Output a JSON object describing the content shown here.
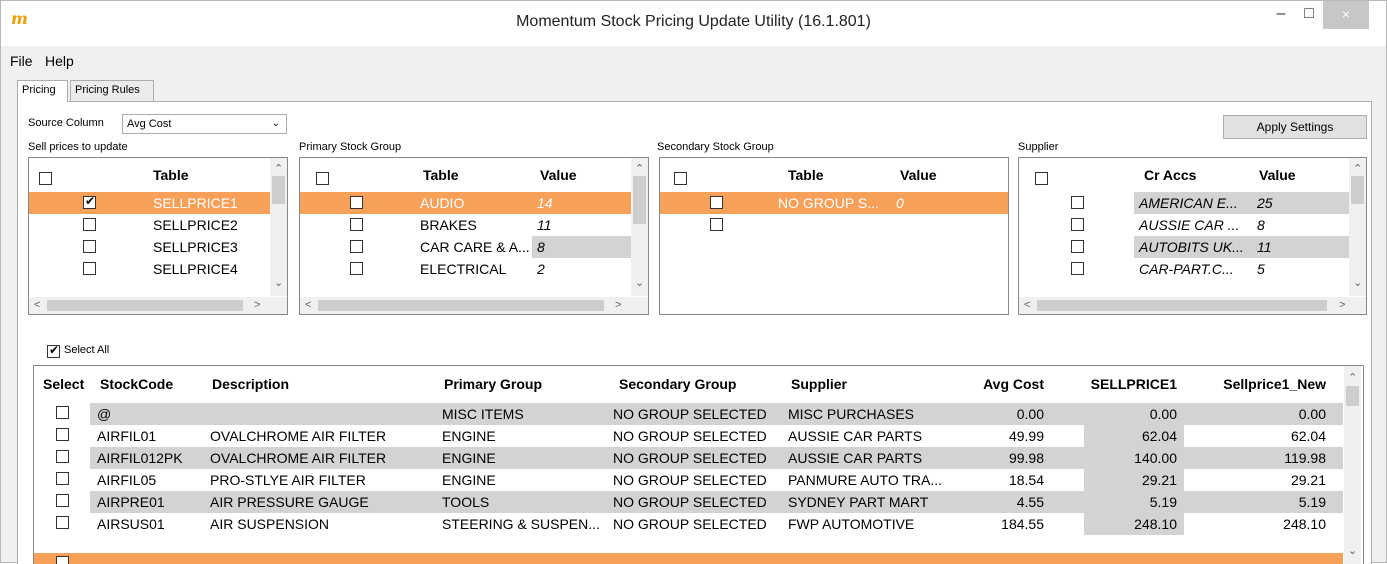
{
  "window": {
    "title": "Momentum Stock Pricing Update Utility (16.1.801)",
    "icon_glyph": "m",
    "min": "–",
    "max": "□",
    "close": "×"
  },
  "menu": {
    "file": "File",
    "help": "Help"
  },
  "tabs": {
    "pricing": "Pricing",
    "rules": "Pricing Rules"
  },
  "source": {
    "label": "Source Column",
    "value": "Avg Cost",
    "arrow": "⌄"
  },
  "apply_button": "Apply Settings",
  "sections": {
    "sell": "Sell prices to update",
    "primary": "Primary Stock Group",
    "secondary": "Secondary Stock Group",
    "supplier": "Supplier"
  },
  "sell_grid": {
    "col_table": "Table",
    "rows": [
      {
        "checked": true,
        "table": "SELLPRICE1"
      },
      {
        "checked": false,
        "table": "SELLPRICE2"
      },
      {
        "checked": false,
        "table": "SELLPRICE3"
      },
      {
        "checked": false,
        "table": "SELLPRICE4"
      }
    ]
  },
  "primary_grid": {
    "col_table": "Table",
    "col_value": "Value",
    "rows": [
      {
        "table": "AUDIO",
        "value": "14"
      },
      {
        "table": "BRAKES",
        "value": "11"
      },
      {
        "table": "CAR CARE & A...",
        "value": "8"
      },
      {
        "table": "ELECTRICAL",
        "value": "2"
      }
    ]
  },
  "secondary_grid": {
    "col_table": "Table",
    "col_value": "Value",
    "rows": [
      {
        "table": "NO GROUP S...",
        "value": "0"
      }
    ]
  },
  "supplier_grid": {
    "col_acc": "Cr Accs",
    "col_value": "Value",
    "rows": [
      {
        "acc": "AMERICAN E...",
        "value": "25"
      },
      {
        "acc": "AUSSIE CAR ...",
        "value": "8"
      },
      {
        "acc": "AUTOBITS UK...",
        "value": "11"
      },
      {
        "acc": "CAR-PART.C...",
        "value": "5"
      }
    ]
  },
  "select_all": "Select All",
  "main_grid": {
    "columns": [
      "Select",
      "StockCode",
      "Description",
      "Primary Group",
      "Secondary Group",
      "Supplier",
      "Avg Cost",
      "SELLPRICE1",
      "Sellprice1_New"
    ],
    "rows": [
      [
        "@",
        "",
        "MISC ITEMS",
        "NO GROUP SELECTED",
        "MISC PURCHASES",
        "0.00",
        "0.00",
        "0.00"
      ],
      [
        "AIRFIL01",
        "OVALCHROME AIR FILTER",
        "ENGINE",
        "NO GROUP SELECTED",
        "AUSSIE CAR PARTS",
        "49.99",
        "62.04",
        "62.04"
      ],
      [
        "AIRFIL012PK",
        "OVALCHROME AIR FILTER",
        "ENGINE",
        "NO GROUP SELECTED",
        "AUSSIE CAR PARTS",
        "99.98",
        "140.00",
        "119.98"
      ],
      [
        "AIRFIL05",
        "PRO-STLYE AIR FILTER",
        "ENGINE",
        "NO GROUP SELECTED",
        "PANMURE AUTO TRA...",
        "18.54",
        "29.21",
        "29.21"
      ],
      [
        "AIRPRE01",
        "AIR PRESSURE GAUGE",
        "TOOLS",
        "NO GROUP SELECTED",
        "SYDNEY PART MART",
        "4.55",
        "5.19",
        "5.19"
      ],
      [
        "AIRSUS01",
        "AIR SUSPENSION",
        "STEERING & SUSPEN...",
        "NO GROUP SELECTED",
        "FWP AUTOMOTIVE",
        "184.55",
        "248.10",
        "248.10"
      ]
    ]
  },
  "scroll": {
    "up": "⌃",
    "down": "⌄",
    "left": "<",
    "right": ">"
  },
  "colors": {
    "selection": "#f7a05a",
    "shade": "#d3d3d3",
    "app_icon": "#f0a000"
  }
}
